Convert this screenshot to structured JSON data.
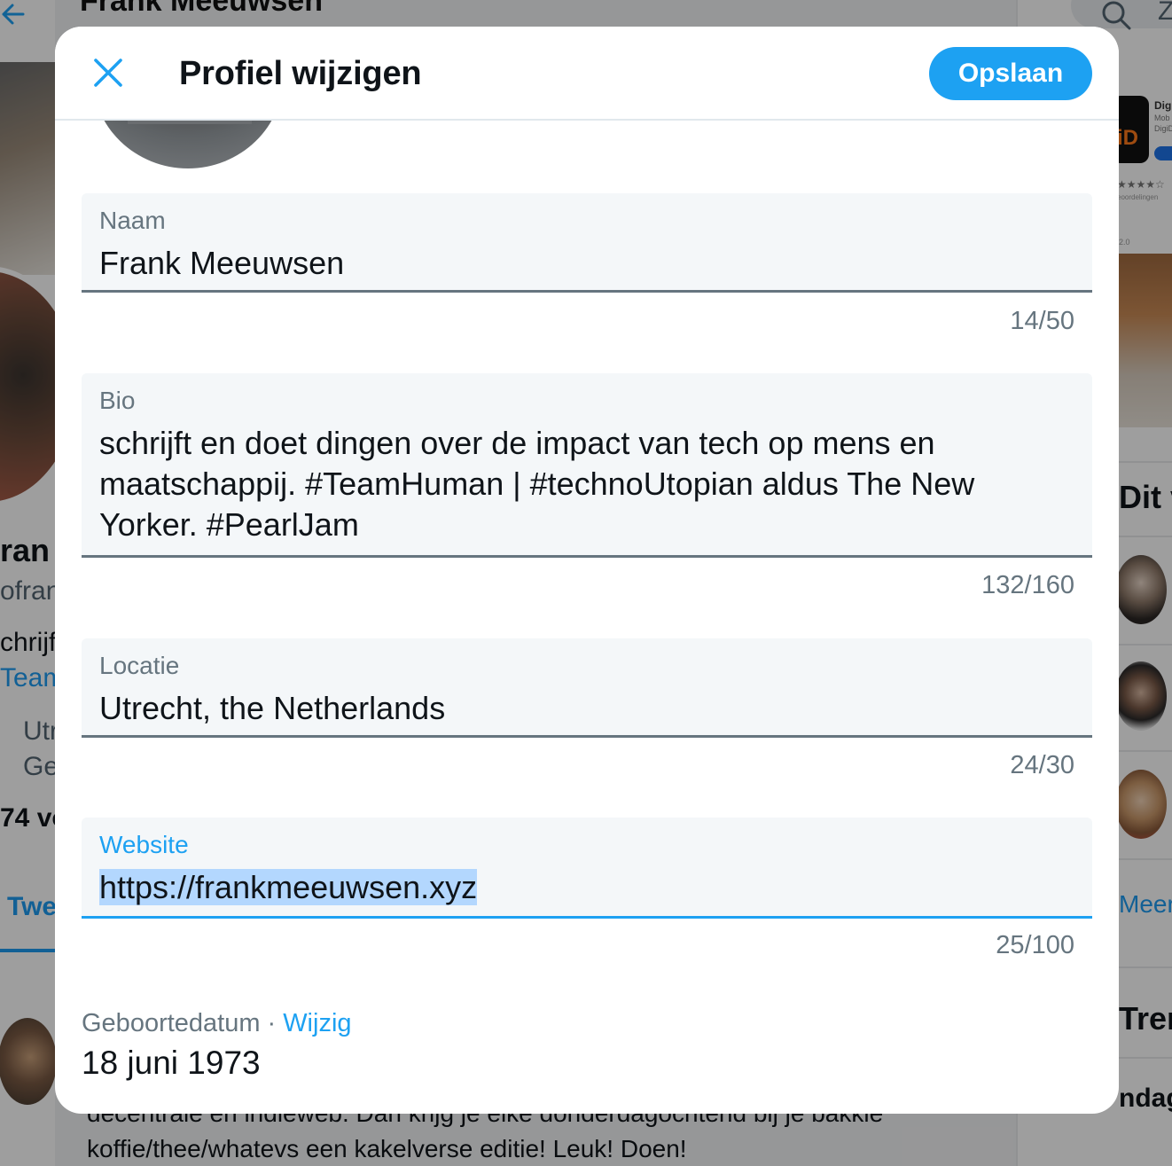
{
  "background": {
    "header_name": "Frank Meeuwsen",
    "left_snippets": {
      "name": "ran",
      "handle": "ofran",
      "bio_1": "chrijf",
      "bio_2": "Team",
      "loc": "Utr",
      "joined": "Ge",
      "stats": "74 vo",
      "tab": "Twe"
    },
    "bottom_text_1": "decentrale en indieweb. Dan krijg je elke donderdagochtend bij je bakkie",
    "bottom_text_2": "koffie/thee/whatevs een kakelverse editie! Leuk! Doen!",
    "right": {
      "search_letter": "Z",
      "app_name": "Digi",
      "app_sub1": "Mob",
      "app_sub2": "DigiD",
      "app_stars": "★★★★☆",
      "app_ratings": "eoordelingen",
      "app_version": "2.0",
      "app_icon_text": "iD",
      "who_heading": "Dit v",
      "more_link": "Meer v",
      "trends_heading": "Tren",
      "trend_item": "ndagv"
    }
  },
  "modal": {
    "title": "Profiel wijzigen",
    "close_icon": "close-icon",
    "save_label": "Opslaan",
    "accent_color": "#1da1f2",
    "fields": {
      "name": {
        "label": "Naam",
        "value": "Frank Meeuwsen",
        "counter": "14/50"
      },
      "bio": {
        "label": "Bio",
        "value": "schrijft en doet dingen over de impact van tech op mens en\nmaatschappij. #TeamHuman | #technoUtopian aldus The New\nYorker. #PearlJam",
        "counter": "132/160"
      },
      "location": {
        "label": "Locatie",
        "value": "Utrecht, the Netherlands",
        "counter": "24/30"
      },
      "website": {
        "label": "Website",
        "value": "https://frankmeeuwsen.xyz",
        "counter": "25/100"
      }
    },
    "birthdate": {
      "label": "Geboortedatum",
      "separator": "·",
      "edit_label": "Wijzig",
      "value": "18 juni 1973"
    }
  }
}
